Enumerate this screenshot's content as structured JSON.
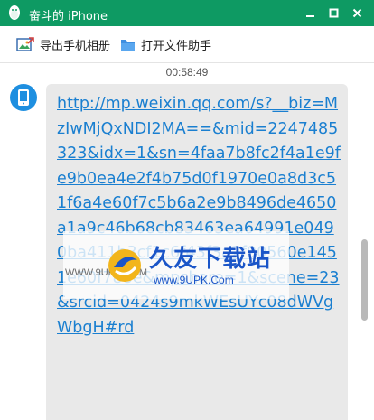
{
  "window": {
    "title": "奋斗的 iPhone",
    "accent_color": "#0e9a63",
    "buttons": [
      "minimize-icon",
      "maximize-icon",
      "close-icon"
    ]
  },
  "toolbar": {
    "export_album_label": "导出手机相册",
    "export_album_icon": "image-export-icon",
    "open_folder_label": "打开文件助手",
    "open_folder_icon": "folder-icon"
  },
  "chat": {
    "timestamp": "00:58:49",
    "sender_icon": "phone-avatar-icon",
    "message_text": "http://mp.weixin.qq.com/s?__biz=MzIwMjQxNDI2MA==&mid=2247485323&idx=1&sn=4faa7b8fc2f4a1e9fe9b0ea4e2f4b75d0f1970e0a8d3c51f6a4e60f7c5b6a2e9b8496de4650a1a9c46b68cb83463ea64991e0490ba411b3cf1c6f43f3a2f90560e1451e60f788e&mpshare=1&scene=23&srcid=0424s9mkWEsUYc08dWVgWbgH#rd",
    "link_color": "#1a7fd0"
  },
  "watermark": {
    "title": "久友下载站",
    "url": "www.9UPK.Com",
    "url_small": "WWW.9UPK.COM"
  }
}
